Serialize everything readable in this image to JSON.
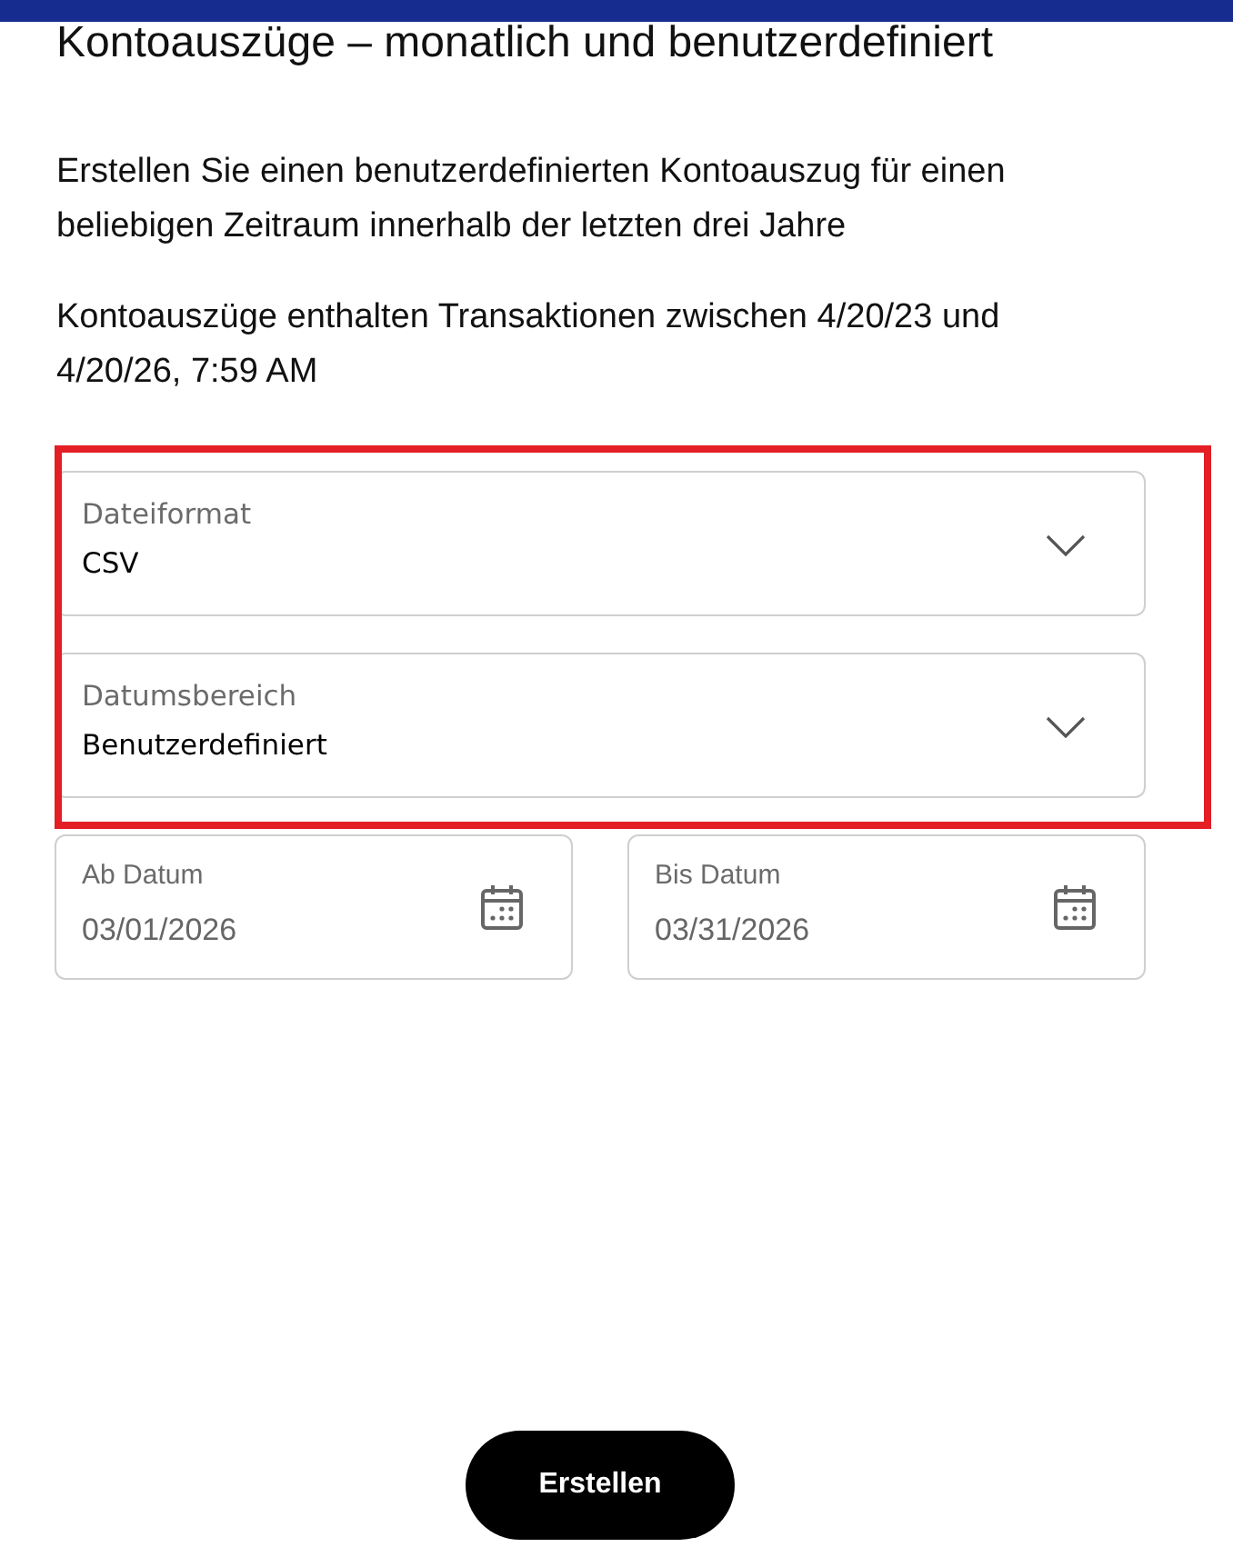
{
  "header": {
    "title": "Kontoauszüge – monatlich und benutzerdefiniert"
  },
  "paragraphs": [
    "Erstellen Sie einen benutzerdefinierten Kontoauszug für einen beliebigen Zeitraum innerhalb der letzten drei Jahre",
    "Kontoauszüge enthalten Transaktionen zwischen 4/20/23 und 4/20/26, 7:59 AM"
  ],
  "select_group": {
    "highlighted": true,
    "selects": [
      {
        "label": "Dateiformat",
        "value": "CSV"
      },
      {
        "label": "Datumsbereich",
        "value": "Benutzerdefiniert"
      }
    ]
  },
  "date_fields": [
    {
      "label": "Ab Datum",
      "value": "03/01/2026"
    },
    {
      "label": "Bis Datum",
      "value": "03/31/2026"
    }
  ],
  "submit_button": {
    "label": "Erstellen"
  }
}
